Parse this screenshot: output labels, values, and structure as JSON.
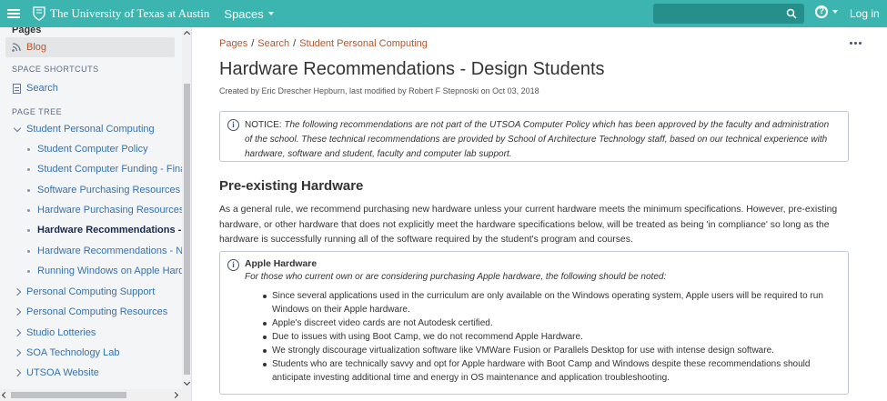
{
  "topbar": {
    "brand": "The University of Texas at Austin",
    "spaces_label": "Spaces",
    "help_icon": "question-circle-icon",
    "login_label": "Log in",
    "colors": {
      "bar": "#3cb4b0",
      "search": "#258f8b"
    }
  },
  "sidebar": {
    "pages_label": "Pages",
    "blog_label": "Blog",
    "shortcuts_heading": "SPACE SHORTCUTS",
    "shortcut_search": "Search",
    "tree_heading": "PAGE TREE",
    "tree": {
      "root": "Student Personal Computing",
      "children": [
        "Student Computer Policy",
        "Student Computer Funding - Finan",
        "Software Purchasing Resources",
        "Hardware Purchasing Resources",
        "Hardware Recommendations - D",
        "Hardware Recommendations - Nor",
        "Running Windows on Apple Hardw",
        "Personal Computing Support",
        "Personal Computing Resources"
      ],
      "siblings": [
        "Studio Lotteries",
        "SOA Technology Lab",
        "UTSOA Website"
      ]
    }
  },
  "main": {
    "breadcrumbs": [
      "Pages",
      "Search",
      "Student Personal Computing"
    ],
    "title": "Hardware Recommendations - Design Students",
    "byline": "Created by Eric Drescher Hepburn, last modified by Robert F Stepnoski on Oct 03, 2018",
    "notice_prefix": "NOTICE: ",
    "notice_text": "The following recommendations are not part of the UTSOA Computer Policy which has been approved by the faculty and administration of the school.  These technical recommendations are provided by School of Architecture Technology staff, based on our technical experience with hardware, software and student, faculty and computer lab support.",
    "section_heading": "Pre-existing Hardware",
    "paragraph": "As a general rule, we recommend purchasing new hardware unless your current hardware meets the minimum specifications.  However, pre-existing hardware, or other hardware that does not explicitly meet the hardware specifications below, will be treated as being 'in compliance' so long as the hardware is successfully running all of the software required by the student's program and courses.",
    "apple_title": "Apple Hardware",
    "apple_subtitle": "For those who current own or are considering purchasing Apple hardware, the following should be noted:",
    "apple_items": [
      "Since several applications used in the curriculum are only available on the Windows operating system, Apple users will be required to run Windows on their Apple hardware.",
      "Apple's discreet video cards are not Autodesk certified.",
      "Due to issues with using Boot Camp, we do not recommend Apple Hardware.",
      "We strongly discourage virtualization software like VMWare Fusion or Parallels Desktop for use with intense design software.",
      "Students who are technically savvy and opt for Apple hardware with Boot Camp and Windows despite these recommendations should anticipate investing additional time and energy in OS maintenance and application troubleshooting."
    ]
  }
}
